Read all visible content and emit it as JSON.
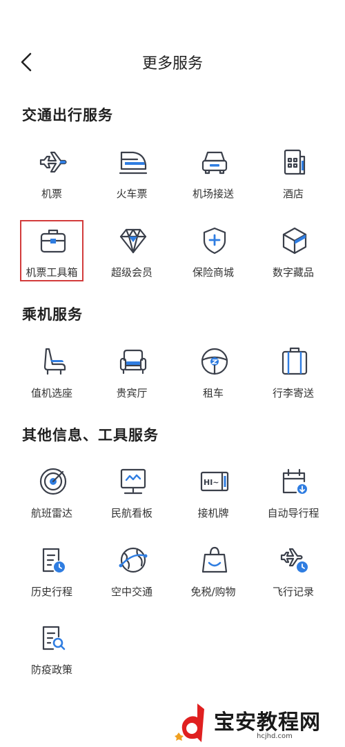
{
  "header": {
    "title": "更多服务"
  },
  "sections": [
    {
      "title": "交通出行服务",
      "items": [
        {
          "label": "机票",
          "icon": "airplane-icon"
        },
        {
          "label": "火车票",
          "icon": "train-icon"
        },
        {
          "label": "机场接送",
          "icon": "car-icon"
        },
        {
          "label": "酒店",
          "icon": "hotel-icon"
        },
        {
          "label": "机票工具箱",
          "icon": "toolbox-icon"
        },
        {
          "label": "超级会员",
          "icon": "diamond-icon"
        },
        {
          "label": "保险商城",
          "icon": "shield-plus-icon"
        },
        {
          "label": "数字藏品",
          "icon": "cube-icon"
        }
      ]
    },
    {
      "title": "乘机服务",
      "items": [
        {
          "label": "值机选座",
          "icon": "seat-icon"
        },
        {
          "label": "贵宾厅",
          "icon": "sofa-icon"
        },
        {
          "label": "租车",
          "icon": "steering-wheel-icon"
        },
        {
          "label": "行李寄送",
          "icon": "luggage-icon"
        }
      ]
    },
    {
      "title": "其他信息、工具服务",
      "items": [
        {
          "label": "航班雷达",
          "icon": "radar-icon"
        },
        {
          "label": "民航看板",
          "icon": "monitor-icon"
        },
        {
          "label": "接机牌",
          "icon": "sign-board-icon"
        },
        {
          "label": "自动导行程",
          "icon": "calendar-import-icon"
        },
        {
          "label": "历史行程",
          "icon": "history-document-icon"
        },
        {
          "label": "空中交通",
          "icon": "globe-route-icon"
        },
        {
          "label": "免税/购物",
          "icon": "shopping-bag-icon"
        },
        {
          "label": "飞行记录",
          "icon": "plane-clock-icon"
        },
        {
          "label": "防疫政策",
          "icon": "policy-search-icon"
        }
      ]
    }
  ],
  "watermark": {
    "text": "宝安教程网",
    "url": "hcjhd.com"
  },
  "colors": {
    "accent": "#2f7de1",
    "highlight": "#d23b3b",
    "icon": "#3a3f4a"
  }
}
